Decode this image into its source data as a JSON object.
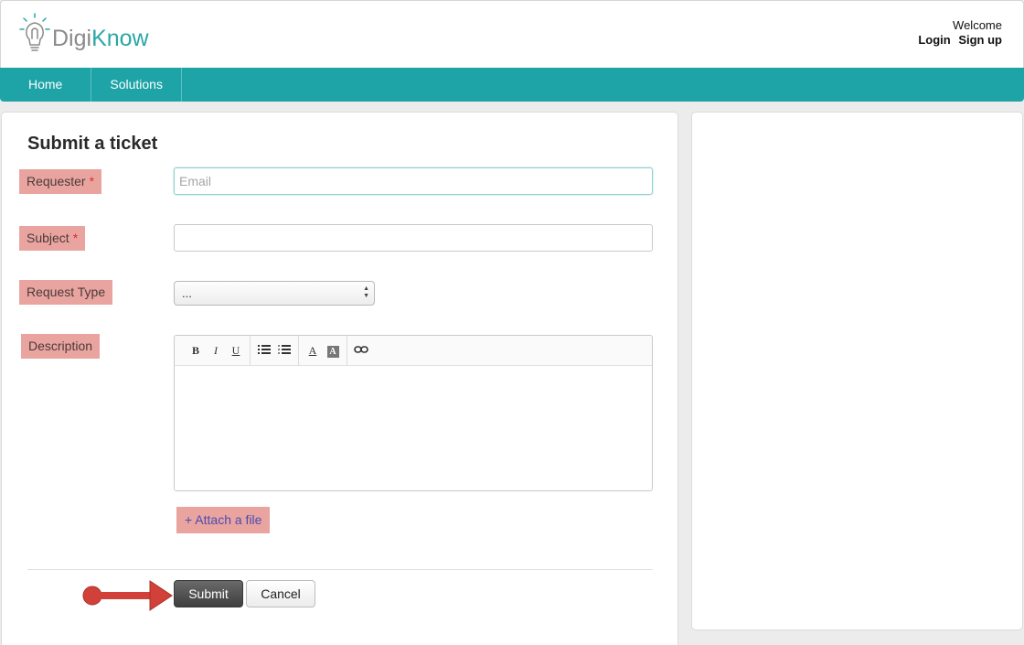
{
  "header": {
    "logo_part1": "Digi",
    "logo_part2": "Know",
    "welcome": "Welcome",
    "login": "Login",
    "signup": "Sign up"
  },
  "nav": {
    "items": [
      {
        "label": "Home"
      },
      {
        "label": "Solutions"
      }
    ]
  },
  "form": {
    "title": "Submit a ticket",
    "requester_label": "Requester",
    "requester_placeholder": "Email",
    "requester_value": "",
    "subject_label": "Subject",
    "subject_value": "",
    "required_mark": "*",
    "request_type_label": "Request Type",
    "request_type_selected": "...",
    "description_label": "Description",
    "toolbar": {
      "bold": "B",
      "italic": "I",
      "underline": "U",
      "font_color": "A",
      "bg_color": "A"
    },
    "attach_label": "+ Attach a file",
    "submit_label": "Submit",
    "cancel_label": "Cancel"
  },
  "colors": {
    "nav_bg": "#1ea3a6",
    "label_highlight": "#e9a4a0",
    "annotation_arrow": "#d1413a"
  }
}
